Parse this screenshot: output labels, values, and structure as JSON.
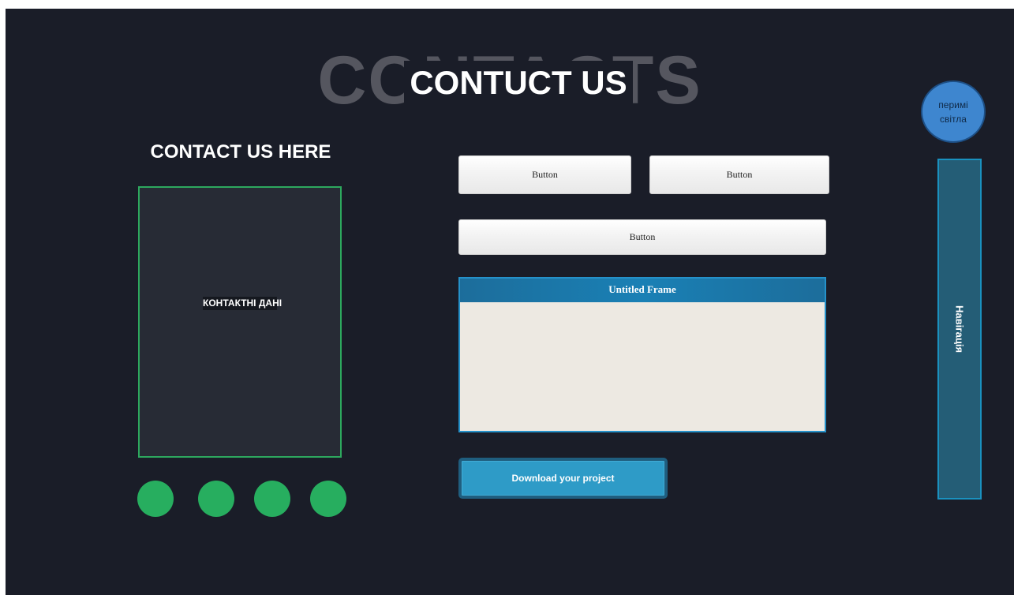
{
  "header": {
    "background_title": "CONTACTS",
    "title": "CONTUCT US"
  },
  "contact": {
    "heading": "CONTACT US HERE",
    "card_label": "КОНТАКТНІ ДАНІ",
    "social_icons": [
      "social-icon",
      "social-icon",
      "social-icon",
      "social-icon"
    ]
  },
  "buttons": {
    "button_1": "Button",
    "button_2": "Button",
    "button_3": "Button",
    "download": "Download your project"
  },
  "frame": {
    "title": "Untitled Frame"
  },
  "theme_toggle": {
    "line1": "перимі",
    "line2": "світла"
  },
  "navigation": {
    "label": "Навігація"
  },
  "colors": {
    "page_background": "#1a1d28",
    "accent_green": "#27ae5f",
    "accent_blue": "#2e9bc7",
    "nav_panel": "#245d76",
    "toggle": "#3e86cf"
  }
}
